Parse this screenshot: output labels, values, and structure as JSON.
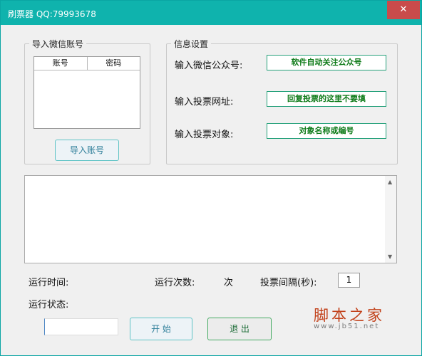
{
  "window": {
    "title": "刷票器  QQ:79993678",
    "close_icon": "✕"
  },
  "import_group": {
    "title": "导入微信账号",
    "columns": [
      "账号",
      "密码"
    ],
    "button": "导入账号"
  },
  "info_group": {
    "title": "信息设置",
    "labels": [
      "输入微信公众号:",
      "输入投票网址:",
      "输入投票对象:"
    ],
    "values": [
      "软件自动关注公众号",
      "回复投票的这里不要填",
      "对象名称或编号"
    ]
  },
  "footer": {
    "run_time_label": "运行时间:",
    "run_count_label": "运行次数:",
    "count_unit": "次",
    "interval_label": "投票间隔(秒):",
    "interval_value": "1",
    "status_label": "运行状态:",
    "start_button": "开 始",
    "exit_button": "退 出"
  },
  "watermark": {
    "text": "脚本之家",
    "url": "www.jb51.net"
  }
}
